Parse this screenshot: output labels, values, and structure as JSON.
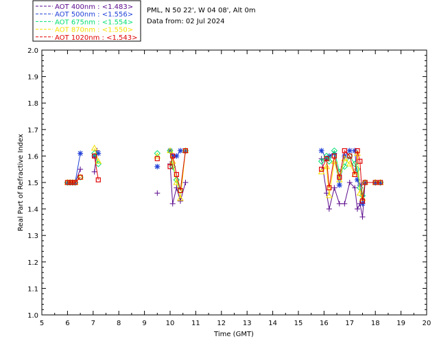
{
  "chart_data": {
    "type": "scatter",
    "site_line": "PML, N 50 22', W 04 08', Alt 0m",
    "date_line": "Data from: 02 Jul 2024",
    "xlabel": "Time (GMT)",
    "ylabel": "Real Part of Refractive Index",
    "xlim": [
      5,
      20
    ],
    "ylim": [
      1.0,
      2.0
    ],
    "xticks": [
      "5",
      "6",
      "7",
      "8",
      "9",
      "10",
      "11",
      "12",
      "13",
      "14",
      "15",
      "16",
      "17",
      "18",
      "19",
      "20"
    ],
    "yticks": [
      "1.0",
      "1.1",
      "1.2",
      "1.3",
      "1.4",
      "1.5",
      "1.6",
      "1.7",
      "1.8",
      "1.9",
      "2.0"
    ],
    "grid": false,
    "legend_position": "top-left",
    "series": [
      {
        "name": "AOT  400nm : <1.483>",
        "color": "#5a0a8c",
        "marker": "plus",
        "segments": [
          [
            [
              6.0,
              1.5
            ],
            [
              6.1,
              1.5
            ],
            [
              6.2,
              1.5
            ],
            [
              6.3,
              1.5
            ],
            [
              6.5,
              1.55
            ]
          ],
          [
            [
              7.05,
              1.54
            ],
            [
              7.15,
              1.62
            ]
          ],
          [
            [
              9.5,
              1.46
            ]
          ],
          [
            [
              10.0,
              1.57
            ],
            [
              10.1,
              1.42
            ],
            [
              10.25,
              1.48
            ],
            [
              10.4,
              1.43
            ],
            [
              10.6,
              1.5
            ]
          ],
          [
            [
              15.9,
              1.59
            ],
            [
              16.1,
              1.46
            ],
            [
              16.2,
              1.4
            ],
            [
              16.4,
              1.48
            ],
            [
              16.6,
              1.42
            ],
            [
              16.8,
              1.42
            ],
            [
              17.0,
              1.5
            ],
            [
              17.2,
              1.48
            ],
            [
              17.3,
              1.4
            ],
            [
              17.4,
              1.42
            ],
            [
              17.5,
              1.37
            ],
            [
              17.6,
              1.5
            ],
            [
              18.0,
              1.5
            ],
            [
              18.2,
              1.5
            ]
          ]
        ]
      },
      {
        "name": "AOT  500nm : <1.556>",
        "color": "#1f3fd6",
        "marker": "star",
        "segments": [
          [
            [
              6.0,
              1.5
            ],
            [
              6.1,
              1.5
            ],
            [
              6.2,
              1.5
            ],
            [
              6.3,
              1.5
            ],
            [
              6.5,
              1.61
            ]
          ],
          [
            [
              7.05,
              1.6
            ],
            [
              7.2,
              1.61
            ]
          ],
          [
            [
              9.5,
              1.56
            ]
          ],
          [
            [
              10.0,
              1.62
            ],
            [
              10.1,
              1.6
            ],
            [
              10.25,
              1.6
            ],
            [
              10.4,
              1.62
            ],
            [
              10.6,
              1.62
            ]
          ],
          [
            [
              15.9,
              1.62
            ],
            [
              16.1,
              1.59
            ],
            [
              16.2,
              1.6
            ],
            [
              16.4,
              1.61
            ],
            [
              16.6,
              1.49
            ],
            [
              16.8,
              1.6
            ],
            [
              17.0,
              1.62
            ],
            [
              17.2,
              1.62
            ],
            [
              17.3,
              1.51
            ],
            [
              17.4,
              1.49
            ],
            [
              17.5,
              1.42
            ],
            [
              17.6,
              1.5
            ],
            [
              18.0,
              1.5
            ],
            [
              18.2,
              1.5
            ]
          ]
        ]
      },
      {
        "name": "AOT  675nm : <1.554>",
        "color": "#00e070",
        "marker": "diamond",
        "segments": [
          [
            [
              6.0,
              1.5
            ],
            [
              6.1,
              1.5
            ],
            [
              6.2,
              1.5
            ],
            [
              6.3,
              1.5
            ],
            [
              6.5,
              1.52
            ]
          ],
          [
            [
              7.05,
              1.61
            ],
            [
              7.2,
              1.57
            ]
          ],
          [
            [
              9.5,
              1.61
            ]
          ],
          [
            [
              10.0,
              1.62
            ],
            [
              10.1,
              1.56
            ],
            [
              10.25,
              1.51
            ],
            [
              10.4,
              1.47
            ],
            [
              10.6,
              1.62
            ]
          ],
          [
            [
              15.9,
              1.58
            ],
            [
              16.1,
              1.6
            ],
            [
              16.2,
              1.58
            ],
            [
              16.4,
              1.62
            ],
            [
              16.6,
              1.54
            ],
            [
              16.8,
              1.56
            ],
            [
              17.0,
              1.6
            ],
            [
              17.2,
              1.57
            ],
            [
              17.3,
              1.55
            ],
            [
              17.4,
              1.48
            ],
            [
              17.5,
              1.45
            ],
            [
              17.6,
              1.5
            ],
            [
              18.0,
              1.5
            ],
            [
              18.2,
              1.5
            ]
          ]
        ]
      },
      {
        "name": "AOT  870nm : <1.550>",
        "color": "#f5e000",
        "marker": "triangle",
        "segments": [
          [
            [
              6.0,
              1.5
            ],
            [
              6.1,
              1.5
            ],
            [
              6.2,
              1.5
            ],
            [
              6.3,
              1.5
            ],
            [
              6.5,
              1.52
            ]
          ],
          [
            [
              7.05,
              1.63
            ],
            [
              7.2,
              1.58
            ]
          ],
          [
            [
              9.5,
              1.6
            ]
          ],
          [
            [
              10.0,
              1.62
            ],
            [
              10.1,
              1.58
            ],
            [
              10.25,
              1.5
            ],
            [
              10.4,
              1.44
            ],
            [
              10.6,
              1.62
            ]
          ],
          [
            [
              15.9,
              1.54
            ],
            [
              16.1,
              1.56
            ],
            [
              16.2,
              1.45
            ],
            [
              16.4,
              1.58
            ],
            [
              16.6,
              1.51
            ],
            [
              16.8,
              1.59
            ],
            [
              17.0,
              1.57
            ],
            [
              17.2,
              1.53
            ],
            [
              17.3,
              1.61
            ],
            [
              17.4,
              1.46
            ],
            [
              17.5,
              1.44
            ],
            [
              17.6,
              1.5
            ],
            [
              18.0,
              1.5
            ],
            [
              18.2,
              1.5
            ]
          ]
        ]
      },
      {
        "name": "AOT 1020nm : <1.543>",
        "color": "#e00000",
        "marker": "square",
        "segments": [
          [
            [
              6.0,
              1.5
            ],
            [
              6.1,
              1.5
            ],
            [
              6.2,
              1.5
            ],
            [
              6.3,
              1.5
            ],
            [
              6.5,
              1.52
            ]
          ],
          [
            [
              7.05,
              1.6
            ],
            [
              7.2,
              1.51
            ]
          ],
          [
            [
              9.5,
              1.59
            ]
          ],
          [
            [
              10.0,
              1.56
            ],
            [
              10.1,
              1.6
            ],
            [
              10.25,
              1.53
            ],
            [
              10.4,
              1.47
            ],
            [
              10.6,
              1.62
            ]
          ],
          [
            [
              15.9,
              1.55
            ],
            [
              16.1,
              1.59
            ],
            [
              16.2,
              1.48
            ],
            [
              16.4,
              1.6
            ],
            [
              16.6,
              1.52
            ],
            [
              16.8,
              1.62
            ],
            [
              17.0,
              1.6
            ],
            [
              17.2,
              1.53
            ],
            [
              17.3,
              1.62
            ],
            [
              17.4,
              1.58
            ],
            [
              17.5,
              1.43
            ],
            [
              17.6,
              1.5
            ],
            [
              18.0,
              1.5
            ],
            [
              18.2,
              1.5
            ]
          ]
        ]
      }
    ]
  }
}
